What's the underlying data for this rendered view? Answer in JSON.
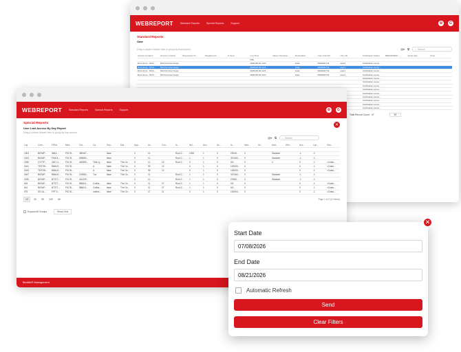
{
  "back_window": {
    "logo": "WEBREPORT",
    "nav": [
      "Standard Reports",
      "Special Reports",
      "Support"
    ],
    "avatar": "G",
    "title": "Standard Reports",
    "subtitle": "Gate",
    "group_hint": "Drag a column header here to group by that column",
    "search_placeholder": "Search",
    "columns": [
      "Access Location",
      "Access Location",
      "Requested To",
      "Department",
      "Is Sent",
      "Log Time",
      "Name Overview",
      "Destination",
      "User Card ID",
      "User ID",
      "Verification Status",
      "IMEIMODEM",
      "Verify App",
      "Zone"
    ],
    "filter_values": [
      "",
      "",
      "",
      "",
      "",
      "NIS",
      "",
      "",
      "",
      "",
      "",
      "",
      "",
      ""
    ],
    "rows": [
      [
        "Root Zone - RCA...",
        "N/A Personel Geçiş",
        "",
        "",
        "",
        "2026-08-30 14:5...",
        "",
        "Gate",
        "0624001711",
        "user1",
        "Verification succe...",
        "",
        "",
        ""
      ],
      [
        "Root Zone - RCA...",
        "N/A Personel Geçiş",
        "",
        "",
        "",
        "2026-08-30 14:5...",
        "",
        "Gate",
        "0624001711",
        "user1",
        "Verification succe...",
        "",
        "",
        ""
      ],
      [
        "Root Zone - RCA...",
        "N/A Personel Geçiş",
        "",
        "",
        "",
        "2026-08-30 14:5...",
        "",
        "Gate",
        "0624001711",
        "user1",
        "Verification succe...",
        "",
        "",
        ""
      ],
      [
        "Root Zone - RCA...",
        "N/A Personel Geçiş",
        "",
        "",
        "",
        "2026-08-30 14:5...",
        "",
        "Gate",
        "0624001711",
        "user1",
        "Verification succe...",
        "",
        "",
        ""
      ],
      [
        "",
        "",
        "",
        "",
        "",
        "",
        "",
        "",
        "",
        "",
        "Verification succe...",
        "",
        "",
        ""
      ],
      [
        "",
        "",
        "",
        "",
        "",
        "",
        "",
        "",
        "",
        "",
        "Verification succe...",
        "",
        "",
        ""
      ],
      [
        "",
        "",
        "",
        "",
        "",
        "",
        "",
        "",
        "",
        "",
        "Verification succe...",
        "",
        "",
        ""
      ],
      [
        "",
        "",
        "",
        "",
        "",
        "",
        "",
        "",
        "",
        "",
        "Verification succe...",
        "",
        "",
        ""
      ],
      [
        "",
        "",
        "",
        "",
        "",
        "",
        "",
        "",
        "",
        "",
        "Verification succe...",
        "",
        "",
        ""
      ],
      [
        "",
        "",
        "",
        "",
        "",
        "",
        "",
        "",
        "",
        "",
        "Verification succe...",
        "",
        "",
        ""
      ],
      [
        "",
        "",
        "",
        "",
        "",
        "",
        "",
        "",
        "",
        "",
        "Verification succe...",
        "",
        "",
        ""
      ],
      [
        "",
        "",
        "",
        "",
        "",
        "",
        "",
        "",
        "",
        "",
        "Verification succe...",
        "",
        "",
        ""
      ],
      [
        "",
        "",
        "",
        "",
        "",
        "",
        "",
        "",
        "",
        "",
        "Verification succe...",
        "",
        "",
        ""
      ]
    ],
    "total_label": "Total Record Count : 47",
    "page_size": "50"
  },
  "front_window": {
    "logo": "WEBREPORT",
    "nav": [
      "Standard Reports",
      "Special Reports",
      "Support"
    ],
    "avatar": "G",
    "title": "Special Reports",
    "subtitle": "User Last Access By Day Report",
    "group_hint": "Drag a column header here to group by that column",
    "search_placeholder": "Search",
    "columns": [
      "Log",
      "Com...",
      "FRNo",
      "Mea...",
      "Cla...",
      "Ca...",
      "Dep...",
      "Dat...",
      "App...",
      "Ac...",
      "Zon...",
      "Is...",
      "IsU...",
      "Acc...",
      "Ac...",
      "Is...",
      "Mes...",
      "Int...",
      "Add...",
      "Wor...",
      "Acc...",
      "Lop...",
      "Gen..."
    ],
    "rows": [
      [
        "1361",
        "BIGWF...",
        "3664-...",
        "FK2 B...",
        "450467...",
        "",
        "false",
        "",
        "0",
        "11",
        "",
        "Root Z...",
        "1006",
        "1",
        "0",
        "23045...",
        "0",
        "",
        "Standart",
        "",
        "-1",
        "-1",
        "",
        "2026-0...",
        "2026-0..."
      ],
      [
        "1513",
        "BIGWF...",
        "FM4 B...",
        "FK2 B...",
        "608562...",
        "",
        "false",
        "",
        "0",
        "11",
        "",
        "Root Z...",
        "1",
        "1",
        "0",
        "307462...",
        "0",
        "",
        "Standart",
        "",
        "-1",
        "-1",
        "",
        "2026-0...",
        "2026-0..."
      ],
      [
        "2260",
        "CVTTF...",
        "2627-3...",
        "FK2 B...",
        "452890...",
        "TAN Ly...",
        "false",
        "The Ce...",
        "5",
        "11",
        "19",
        "Root Z...",
        "3",
        "1",
        "0",
        "0/0",
        "0",
        "",
        "4",
        "",
        "0",
        "-1",
        "<Custo...",
        "2026-0...",
        "2026-0..."
      ],
      [
        "2441",
        "TESTW...",
        "8546-8...",
        "FK2 B...",
        "",
        "A",
        "false",
        "The Ce...",
        "0",
        "99",
        "10",
        "",
        "0",
        "1",
        "0",
        "100000...",
        "0",
        "",
        "",
        "",
        "0",
        "-1",
        "<Custo...",
        "2026-0...",
        "2026-0..."
      ],
      [
        "2443",
        "TESTW...",
        "8546-8...",
        "FK2 B...",
        "",
        "A",
        "false",
        "The Ce...",
        "0",
        "99",
        "10",
        "",
        "0",
        "1",
        "0",
        "100000...",
        "0",
        "",
        "",
        "",
        "0",
        "-1",
        "<Custo...",
        "2026-0...",
        "2026-0..."
      ],
      [
        "2467",
        "BIGWF...",
        "8546-8...",
        "FK2 B...",
        "119562...",
        "Tun",
        "false",
        "The Ce...",
        "0",
        "11",
        "",
        "Root Z...",
        "1",
        "1",
        "0",
        "307462...",
        "0",
        "",
        "Standart",
        "",
        "-1",
        "-1",
        "",
        "2026-0...",
        "2026-0..."
      ],
      [
        "2430",
        "BIGWF...",
        "B7377-...",
        "FK2 B...",
        "441329...",
        "",
        "",
        "",
        "0",
        "11",
        "",
        "Root Z...",
        "1",
        "1",
        "0",
        "27663...",
        "0",
        "",
        "Standart",
        "",
        "-1",
        "-1",
        "",
        "2026-0...",
        "2026-0..."
      ],
      [
        "604",
        "BIGWF...",
        "B7377-...",
        "FK2 B...",
        "886611...",
        "Coltha...",
        "false",
        "The Ce...",
        "0",
        "11",
        "27",
        "Root Z...",
        "1",
        "1",
        "0",
        "0/0",
        "0",
        "",
        "",
        "",
        "0",
        "-1",
        "<Custo...",
        "2026-0...",
        "2026-0..."
      ],
      [
        "641",
        "BIGWF...",
        "B7377-...",
        "FK2 B...",
        "886611...",
        "Coltha...",
        "false",
        "The Ce...",
        "0",
        "11",
        "27",
        "Root Z...",
        "1",
        "1",
        "0",
        "0/0",
        "0",
        "",
        "",
        "",
        "0",
        "-1",
        "<Custo...",
        "2026-0...",
        "2026-0..."
      ],
      [
        "276",
        "09-CA...",
        "FFF 4...",
        "FK2 B...",
        "",
        "undine...",
        "false",
        "The Ce...",
        "0",
        "17",
        "11",
        "",
        "0",
        "1",
        "0",
        "100000...",
        "0",
        "",
        "",
        "",
        "0",
        "-1",
        "<Custo...",
        "2026-0...",
        "2026-0..."
      ]
    ],
    "pager": [
      "10",
      "20",
      "50",
      "100",
      "All"
    ],
    "page_info": "Page 1 of 2 (10 items)",
    "expand_groups": "Expand All Groups",
    "reset_label": "Reset Grid",
    "bottom_bar": "BioAffix® Management"
  },
  "filter_panel": {
    "start_label": "Start Date",
    "start_value": "07/08/2026",
    "end_label": "End Date",
    "end_value": "08/21/2026",
    "auto_refresh_label": "Automatic Refresh",
    "send_label": "Send",
    "clear_label": "Clear Filters",
    "close_glyph": "✕"
  },
  "colors": {
    "brand": "#d7161e",
    "selection": "#3d8ee2"
  },
  "icons": [
    "close-icon",
    "gear-icon",
    "user-icon",
    "search-icon",
    "filter-icon",
    "export-icon"
  ]
}
